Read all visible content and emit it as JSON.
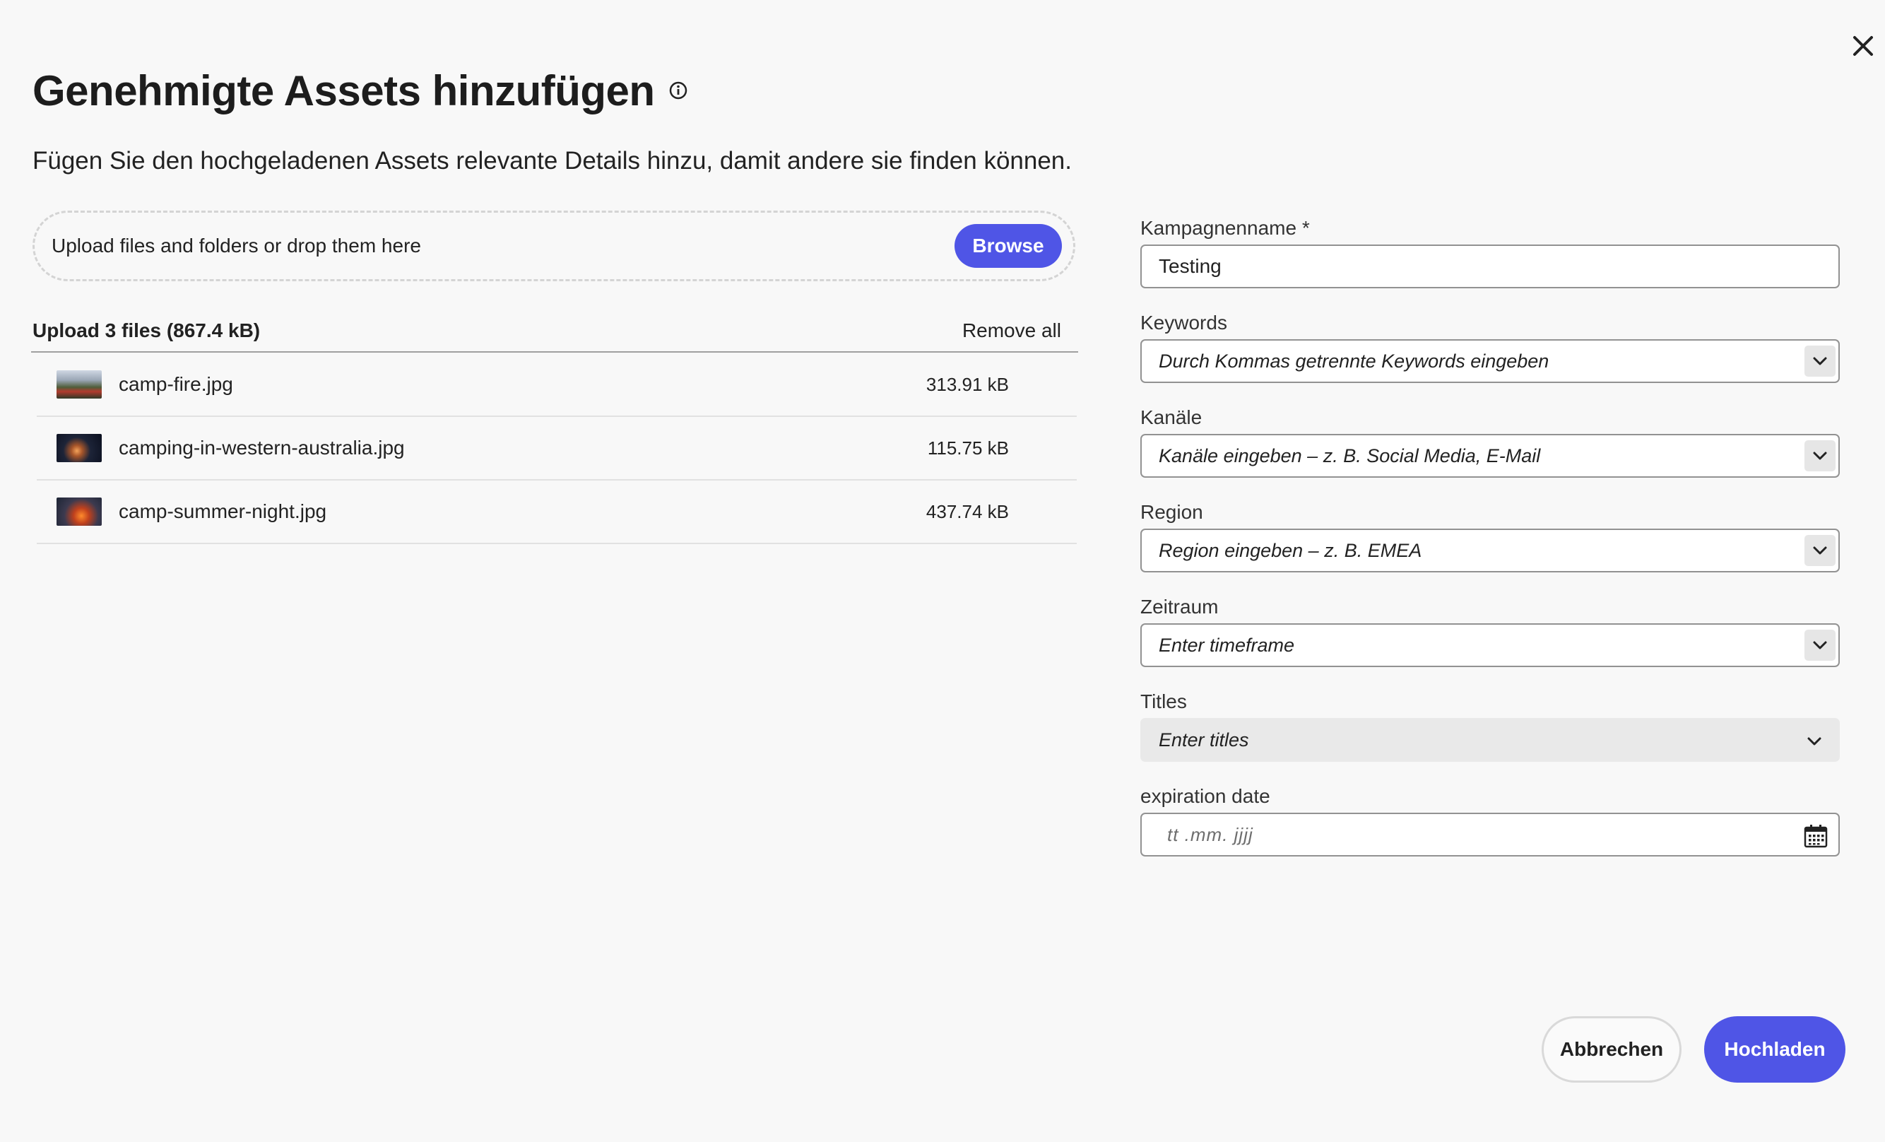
{
  "dialog": {
    "title": "Genehmigte Assets hinzufügen",
    "subtitle": "Fügen Sie den hochgeladenen Assets relevante Details hinzu, damit andere sie finden können."
  },
  "dropzone": {
    "text": "Upload files and folders or drop them here",
    "browse_label": "Browse"
  },
  "upload_list": {
    "header": "Upload 3 files (867.4 kB)",
    "remove_all_label": "Remove all",
    "files": [
      {
        "name": "camp-fire.jpg",
        "size": "313.91 kB"
      },
      {
        "name": "camping-in-western-australia.jpg",
        "size": "115.75 kB"
      },
      {
        "name": "camp-summer-night.jpg",
        "size": "437.74 kB"
      }
    ]
  },
  "form": {
    "campaign_name": {
      "label": "Kampagnenname *",
      "value": "Testing"
    },
    "keywords": {
      "label": "Keywords",
      "placeholder": "Durch Kommas getrennte Keywords eingeben"
    },
    "channels": {
      "label": "Kanäle",
      "placeholder": "Kanäle eingeben – z. B. Social Media, E-Mail"
    },
    "region": {
      "label": "Region",
      "placeholder": "Region eingeben – z. B. EMEA"
    },
    "timeframe": {
      "label": "Zeitraum",
      "placeholder": "Enter timeframe"
    },
    "titles": {
      "label": "Titles",
      "placeholder": "Enter titles"
    },
    "expiration_date": {
      "label": "expiration date",
      "placeholder": "tt .mm.  jjjj"
    }
  },
  "footer": {
    "cancel_label": "Abbrechen",
    "upload_label": "Hochladen"
  },
  "colors": {
    "accent": "#4f55e6",
    "background": "#f8f8f8"
  }
}
